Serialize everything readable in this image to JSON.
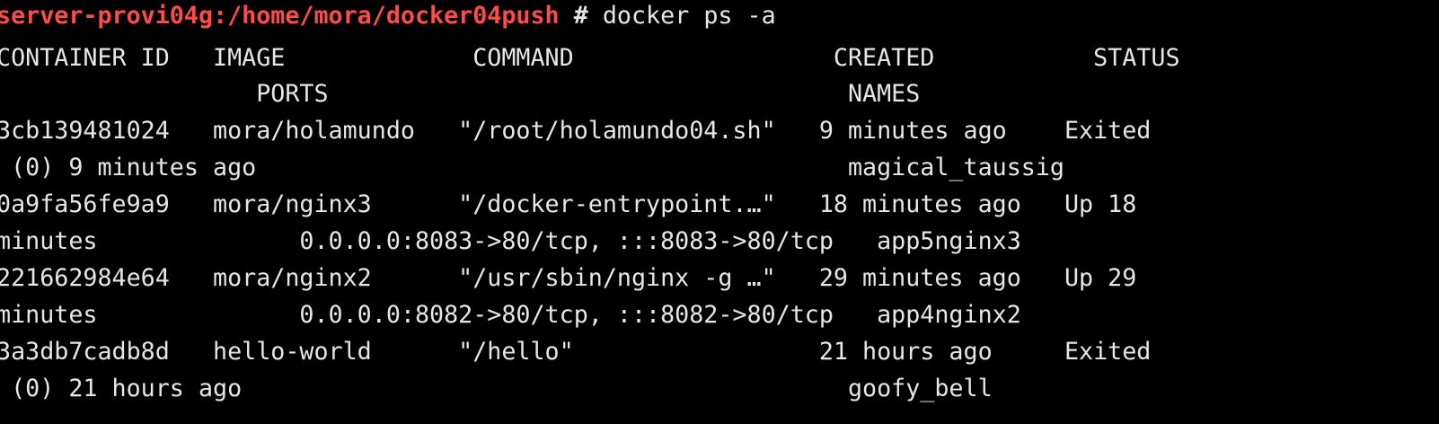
{
  "terminal": {
    "prompt_user_host": "server-provi04g:/home/mora/docker04push",
    "prompt_symbol": "#",
    "command": "docker ps -a",
    "lines": [
      "CONTAINER ID   IMAGE             COMMAND                  CREATED           STATUS",
      "                  PORTS                                    NAMES",
      "3cb139481024   mora/holamundo   \"/root/holamundo04.sh\"   9 minutes ago    Exited",
      " (0) 9 minutes ago                                         magical_taussig",
      "0a9fa56fe9a9   mora/nginx3      \"/docker-entrypoint.…\"   18 minutes ago   Up 18",
      "minutes              0.0.0.0:8083->80/tcp, :::8083->80/tcp   app5nginx3",
      "221662984e64   mora/nginx2      \"/usr/sbin/nginx -g …\"   29 minutes ago   Up 29",
      "minutes              0.0.0.0:8082->80/tcp, :::8082->80/tcp   app4nginx2",
      "3a3db7cadb8d   hello-world      \"/hello\"                 21 hours ago     Exited",
      " (0) 21 hours ago                                          goofy_bell"
    ]
  }
}
